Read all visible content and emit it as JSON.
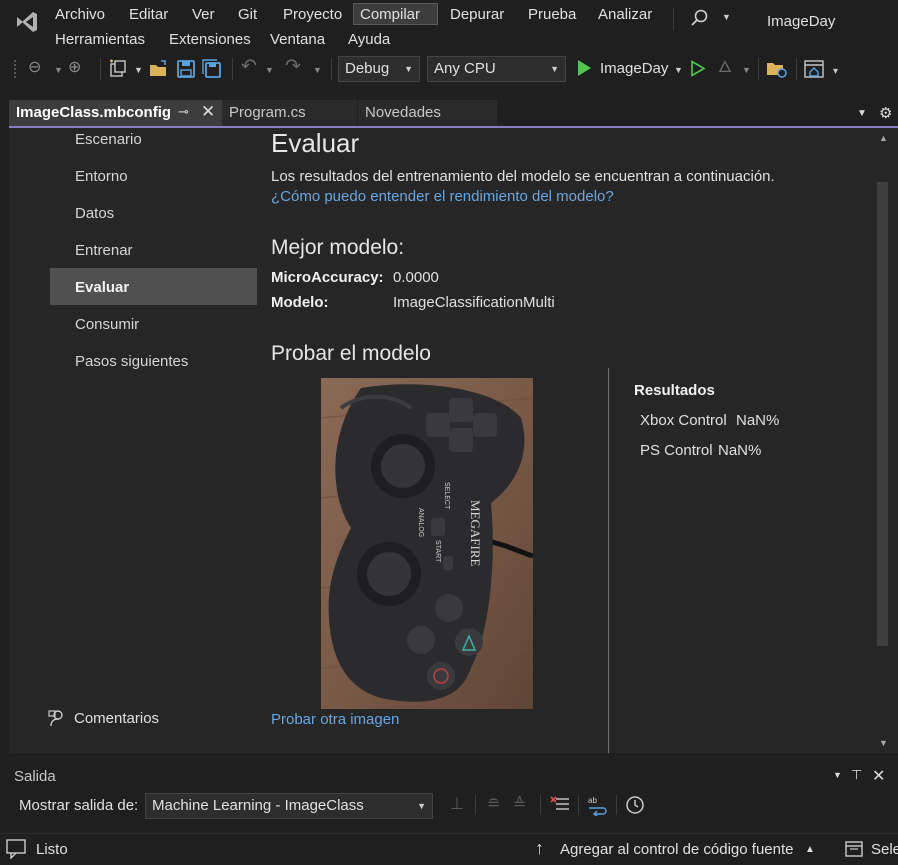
{
  "menu": {
    "items": [
      "Archivo",
      "Editar",
      "Ver",
      "Git",
      "Proyecto",
      "Compilar",
      "Depurar",
      "Prueba",
      "Analizar",
      "Herramientas",
      "Extensiones",
      "Ventana",
      "Ayuda"
    ],
    "active": "Compilar"
  },
  "solution_name": "ImageDay",
  "toolbar": {
    "configuration": "Debug",
    "platform": "Any CPU",
    "run_label": "ImageDay"
  },
  "tabs": [
    {
      "label": "ImageClass.mbconfig",
      "active": true
    },
    {
      "label": "Program.cs",
      "active": false
    },
    {
      "label": "Novedades",
      "active": false
    }
  ],
  "nav": {
    "items": [
      "Escenario",
      "Entorno",
      "Datos",
      "Entrenar",
      "Evaluar",
      "Consumir",
      "Pasos siguientes"
    ],
    "selected": "Evaluar",
    "feedback": "Comentarios"
  },
  "evaluate": {
    "title": "Evaluar",
    "description": "Los resultados del entrenamiento del modelo se encuentran a continuación.",
    "help_link": "¿Cómo puedo entender el rendimiento del modelo?",
    "best_model_title": "Mejor modelo:",
    "metric_label": "MicroAccuracy:",
    "metric_value": "0.0000",
    "model_label": "Modelo:",
    "model_value": "ImageClassificationMulti",
    "test_title": "Probar el modelo",
    "try_another": "Probar otra imagen",
    "results_title": "Resultados",
    "results": [
      {
        "label": "Xbox Control",
        "value": "NaN%"
      },
      {
        "label": "PS Control",
        "value": "NaN%"
      }
    ],
    "image_brand": "MEGAFIRE",
    "image_buttons": [
      "SELECT",
      "ANALOG",
      "START"
    ]
  },
  "output": {
    "title": "Salida",
    "show_label": "Mostrar salida de:",
    "source": "Machine Learning - ImageClass"
  },
  "status": {
    "ready": "Listo",
    "source_control": "Agregar al control de código fuente",
    "select_repo": "Sele"
  },
  "colors": {
    "accent": "#8b7bc7",
    "link": "#6aa6e0",
    "run_green": "#4ec94e"
  }
}
